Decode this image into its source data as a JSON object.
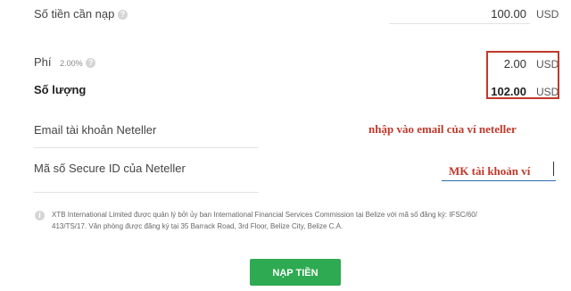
{
  "deposit": {
    "amount_label": "Số tiền cần nạp",
    "amount_value": "100.00",
    "currency": "USD"
  },
  "fee": {
    "label": "Phí",
    "percent": "2.00%",
    "value": "2.00",
    "currency": "USD"
  },
  "quantity": {
    "label": "Số lượng",
    "value": "102.00",
    "currency": "USD"
  },
  "email_field": {
    "label": "Email tài khoản Neteller",
    "annotation": "nhập vào email của ví neteller"
  },
  "secure_id_field": {
    "label": "Mã số Secure ID của Neteller",
    "annotation": "MK tài khoản ví"
  },
  "disclaimer": {
    "line1": "XTB International Limited được quản lý bởi ủy ban International Financial Services Commission tại Belize với mã số đăng ký: IFSC/60/",
    "line2": "413/TS/17. Văn phòng được đăng ký tại 35 Barrack Road, 3rd Floor, Belize City, Belize C.A."
  },
  "submit_label": "NẠP TIỀN",
  "colors": {
    "accent": "#2eaa52",
    "annotation": "#c0392b"
  }
}
